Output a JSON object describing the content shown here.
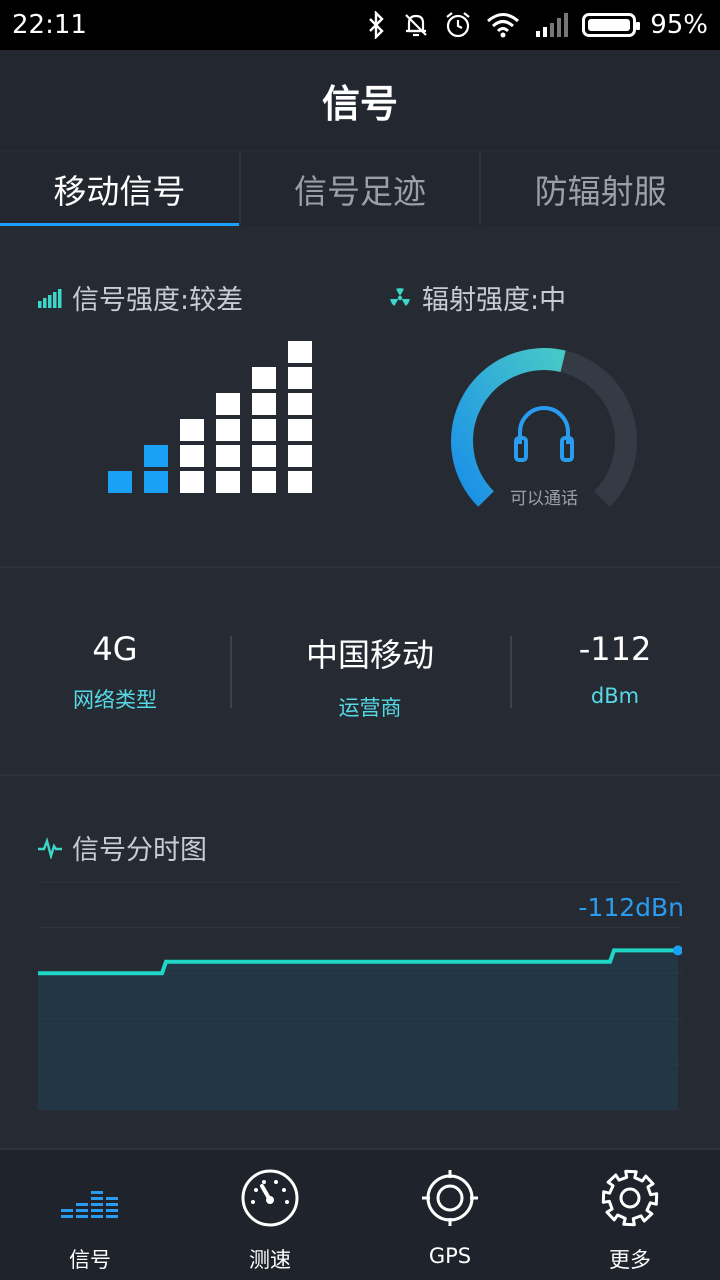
{
  "status_bar": {
    "time": "22:11",
    "battery_percent": "95%",
    "icons": [
      "bluetooth-icon",
      "mute-icon",
      "alarm-icon",
      "wifi-icon",
      "cell-signal-icon",
      "battery-icon"
    ]
  },
  "title": "信号",
  "tabs": [
    {
      "label": "移动信号",
      "active": true
    },
    {
      "label": "信号足迹",
      "active": false
    },
    {
      "label": "防辐射服",
      "active": false
    }
  ],
  "signal_section": {
    "signal_label": "信号强度:较差",
    "radiation_label": "辐射强度:中",
    "signal_level": 2,
    "signal_max": 6,
    "gauge_caption": "可以通话",
    "gauge_fraction": 0.55,
    "colors": {
      "accent": "#1aa0f5",
      "teal": "#3cd7c8"
    }
  },
  "stats": [
    {
      "value": "4G",
      "label": "网络类型"
    },
    {
      "value": "中国移动",
      "label": "运营商"
    },
    {
      "value": "-112",
      "label": "dBm"
    }
  ],
  "chart_section": {
    "label": "信号分时图",
    "current_value": "-112dBn"
  },
  "chart_data": {
    "type": "area",
    "x": [
      0,
      1,
      2,
      3,
      4,
      5,
      6,
      7,
      8,
      9,
      10
    ],
    "values": [
      -116,
      -116,
      -114,
      -114,
      -114,
      -114,
      -114,
      -114,
      -114,
      -112,
      -112
    ],
    "ylim": [
      -140,
      -100
    ],
    "grid": true,
    "colors": {
      "line": "#1fd6c6",
      "fill": "#233b4c",
      "endpoint": "#1aa0f5"
    }
  },
  "bottom_nav": [
    {
      "label": "信号",
      "icon": "signal-bars-icon",
      "active": true
    },
    {
      "label": "测速",
      "icon": "speedometer-icon",
      "active": false
    },
    {
      "label": "GPS",
      "icon": "crosshair-icon",
      "active": false
    },
    {
      "label": "更多",
      "icon": "gear-icon",
      "active": false
    }
  ]
}
